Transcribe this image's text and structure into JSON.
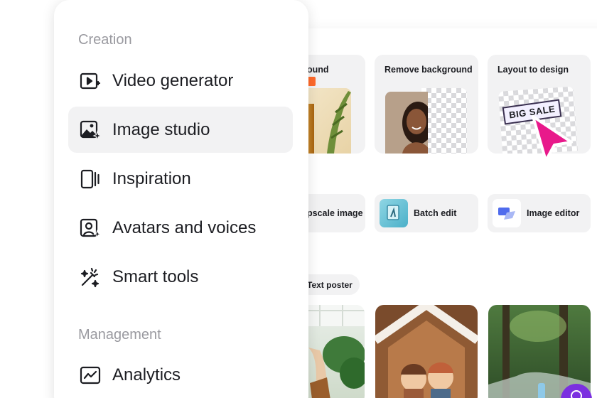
{
  "menu": {
    "sections": [
      {
        "label": "Creation",
        "items": [
          {
            "label": "Video generator",
            "icon": "video-play-icon"
          },
          {
            "label": "Image studio",
            "icon": "image-sparkle-icon",
            "active": true
          },
          {
            "label": "Inspiration",
            "icon": "cards-stack-icon"
          },
          {
            "label": "Avatars and voices",
            "icon": "avatar-sparkle-icon"
          },
          {
            "label": "Smart tools",
            "icon": "magic-wand-icon"
          }
        ]
      },
      {
        "label": "Management",
        "items": [
          {
            "label": "Analytics",
            "icon": "analytics-chart-icon"
          }
        ]
      }
    ]
  },
  "background": {
    "feature_cards": [
      {
        "title": "ound"
      },
      {
        "title": "Remove background"
      },
      {
        "title": "Layout to design",
        "sticker": "BIG SALE"
      }
    ],
    "tools": [
      {
        "label": "pscale image"
      },
      {
        "label": "Batch edit",
        "icon": "batch-edit-icon"
      },
      {
        "label": "Image editor",
        "icon": "image-editor-icon"
      }
    ],
    "chip": {
      "label": "Text poster"
    }
  },
  "colors": {
    "accent_pink": "#e8198b",
    "badge_orange": "#ff6a2b",
    "active_bg": "#f2f2f3",
    "section_gray": "#9a9aa0"
  }
}
